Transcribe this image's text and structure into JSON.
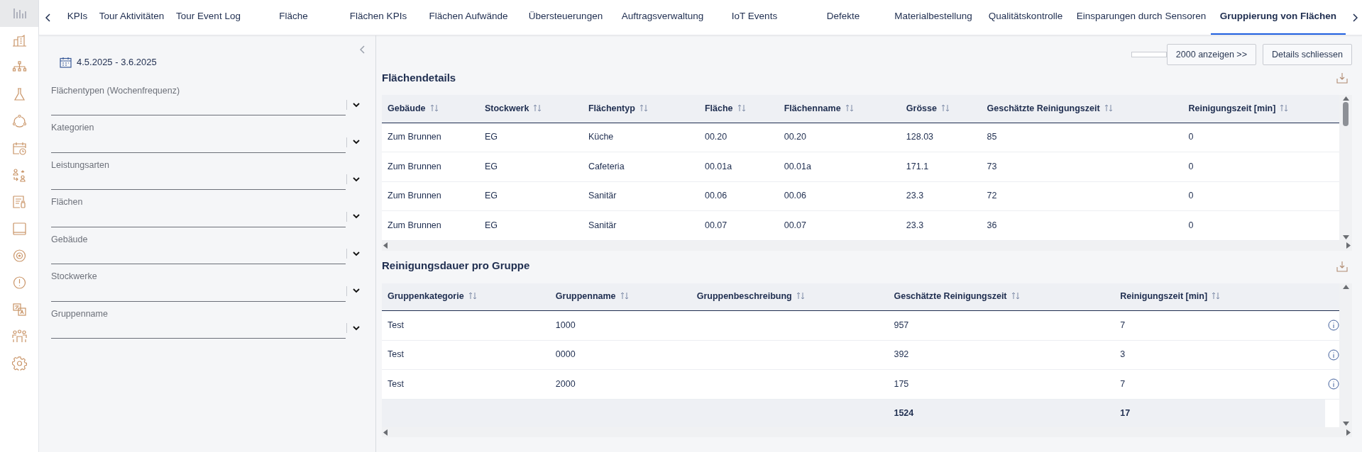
{
  "nav": [
    {
      "kind": "chart",
      "selected": true
    },
    {
      "kind": "building",
      "selected": false
    },
    {
      "kind": "hierarchy",
      "selected": false
    },
    {
      "kind": "flask",
      "selected": false
    },
    {
      "kind": "cycle",
      "selected": false
    },
    {
      "kind": "calendar",
      "selected": false
    },
    {
      "kind": "swap",
      "selected": false
    },
    {
      "kind": "report",
      "selected": false
    },
    {
      "kind": "panel",
      "selected": false
    },
    {
      "kind": "target",
      "selected": false
    },
    {
      "kind": "alert",
      "selected": false
    },
    {
      "kind": "translate",
      "selected": false
    },
    {
      "kind": "group",
      "selected": false
    },
    {
      "kind": "gear",
      "selected": false
    }
  ],
  "tabs": [
    {
      "label": "KPIs",
      "selected": false
    },
    {
      "label": "Tour Aktivitäten",
      "selected": false
    },
    {
      "label": "Tour Event Log",
      "selected": false
    },
    {
      "label": "Fläche",
      "selected": false
    },
    {
      "label": "Flächen KPIs",
      "selected": false
    },
    {
      "label": "Flächen Aufwände",
      "selected": false
    },
    {
      "label": "Übersteuerungen",
      "selected": false
    },
    {
      "label": "Auftragsverwaltung",
      "selected": false
    },
    {
      "label": "IoT Events",
      "selected": false
    },
    {
      "label": "Defekte",
      "selected": false
    },
    {
      "label": "Materialbestellung",
      "selected": false
    },
    {
      "label": "Qualitätskontrolle",
      "selected": false
    },
    {
      "label": "Einsparungen durch Sensoren",
      "selected": false
    },
    {
      "label": "Gruppierung von Flächen",
      "selected": true
    }
  ],
  "filters": {
    "date_range": "4.5.2025 - 3.6.2025",
    "fields": [
      {
        "placeholder": "Flächentypen (Wochenfrequenz)"
      },
      {
        "placeholder": "Kategorien"
      },
      {
        "placeholder": "Leistungsarten"
      },
      {
        "placeholder": "Flächen"
      },
      {
        "placeholder": "Gebäude"
      },
      {
        "placeholder": "Stockwerke"
      },
      {
        "placeholder": "Gruppenname"
      }
    ]
  },
  "actions": [
    "2000 anzeigen >>",
    "Details schliessen"
  ],
  "details": {
    "title": "Flächendetails",
    "columns": [
      "Gebäude",
      "Stockwerk",
      "Flächentyp",
      "Fläche",
      "Flächenname",
      "Grösse",
      "Geschätzte Reinigungszeit",
      "Reinigungszeit [min]"
    ],
    "rows": [
      [
        "Zum Brunnen",
        "EG",
        "Küche",
        "00.20",
        "00.20",
        "128.03",
        "85",
        "0"
      ],
      [
        "Zum Brunnen",
        "EG",
        "Cafeteria",
        "00.01a",
        "00.01a",
        "171.1",
        "73",
        "0"
      ],
      [
        "Zum Brunnen",
        "EG",
        "Sanitär",
        "00.06",
        "00.06",
        "23.3",
        "72",
        "0"
      ],
      [
        "Zum Brunnen",
        "EG",
        "Sanitär",
        "00.07",
        "00.07",
        "23.3",
        "36",
        "0"
      ]
    ]
  },
  "groups": {
    "title": "Reinigungsdauer pro Gruppe",
    "columns": [
      "Gruppenkategorie",
      "Gruppenname",
      "Gruppenbeschreibung",
      "Geschätzte Reinigungszeit",
      "Reinigungszeit [min]"
    ],
    "rows": [
      [
        "Test",
        "1000",
        "",
        "957",
        "7"
      ],
      [
        "Test",
        "0000",
        "",
        "392",
        "3"
      ],
      [
        "Test",
        "2000",
        "",
        "175",
        "7"
      ]
    ],
    "totals": {
      "estimated": "1524",
      "minutes": "17"
    }
  }
}
